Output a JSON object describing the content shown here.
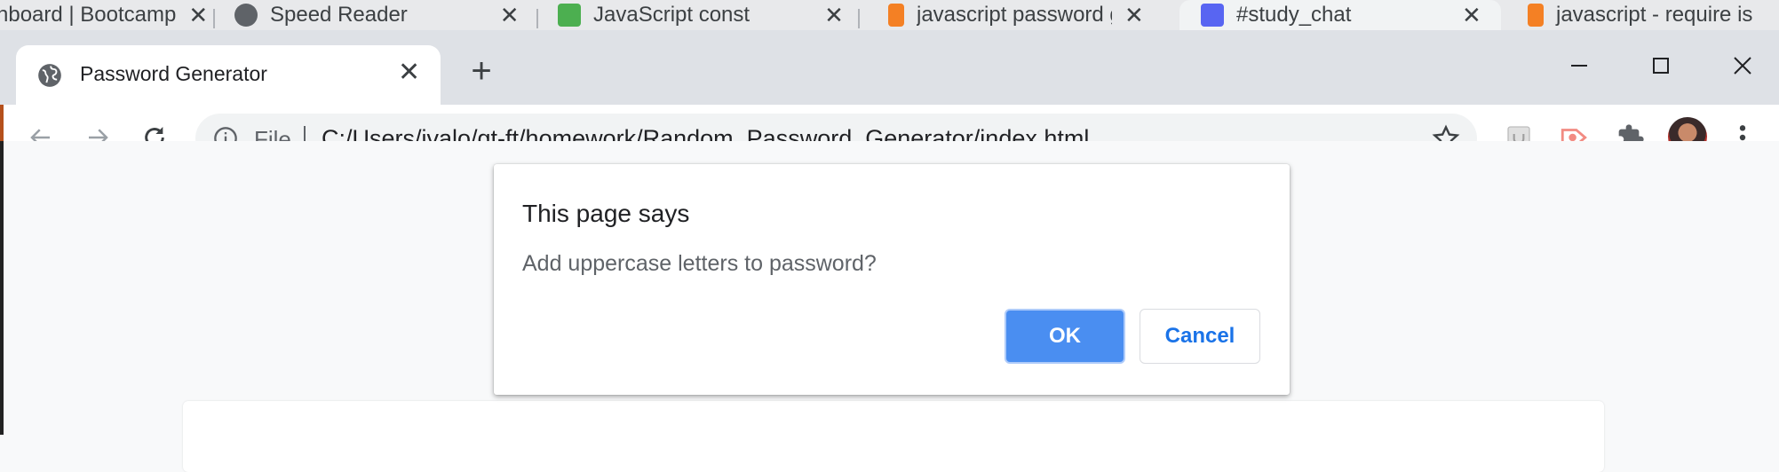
{
  "background_tabs": [
    {
      "title": "hboard | Bootcamp",
      "icon": "generic-page-icon"
    },
    {
      "title": "Speed Reader",
      "icon": "globe-icon"
    },
    {
      "title": "JavaScript const",
      "icon": "w3schools-icon"
    },
    {
      "title": "javascript password ge",
      "icon": "stackoverflow-icon"
    },
    {
      "title": "#study_chat",
      "icon": "discord-icon"
    },
    {
      "title": "javascript - require is",
      "icon": "stackoverflow-icon"
    }
  ],
  "window": {
    "tab": {
      "title": "Password Generator",
      "icon": "globe-icon"
    },
    "new_tab_label": "+"
  },
  "toolbar": {
    "scheme_label": "File",
    "url": "C:/Users/jvalo/gt-ft/homework/Random_Password_Generator/index.html"
  },
  "dialog": {
    "title": "This page says",
    "message": "Add uppercase letters to password?",
    "ok_label": "OK",
    "cancel_label": "Cancel"
  },
  "colors": {
    "accent": "#4a8ef1",
    "link_blue": "#1a73e8",
    "tabbar": "#dee1e6"
  }
}
